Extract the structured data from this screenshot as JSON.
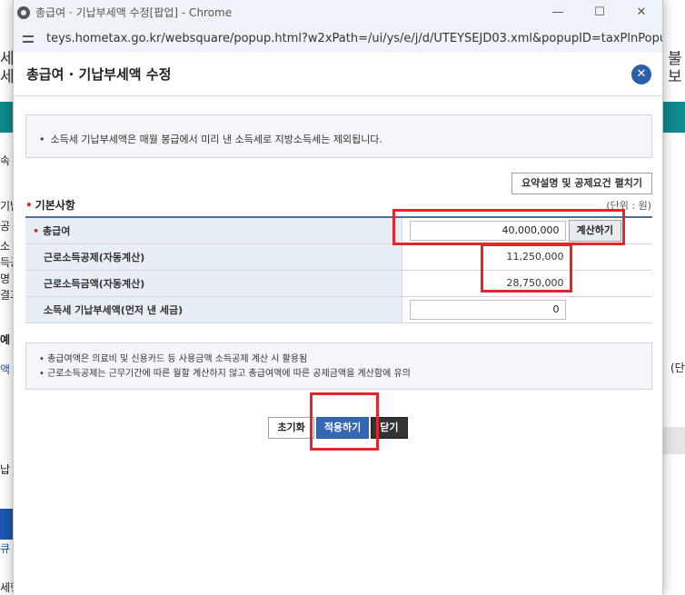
{
  "window": {
    "title": "총급여 · 기납부세액 수정[팝업] - Chrome",
    "url": "teys.hometax.go.kr/websquare/popup.html?w2xPath=/ui/ys/e/j/d/UTEYSEJD03.xml&popupID=taxPlnPopup&idx=idx..."
  },
  "popup": {
    "title": "총급여 · 기납부세액 수정",
    "notice": "소득세 기납부세액은 매월 봉급에서 미리 낸 소득세로 지방소득세는 제외됩니다.",
    "summary_button": "요약설명 및 공제요건 펼치기",
    "section_title": "기본사항",
    "unit_label": "(단위 : 원)",
    "rows": {
      "gross_salary": {
        "label": "총급여",
        "value": "40,000,000",
        "calc_button": "계산하기"
      },
      "earned_income_deduction": {
        "label": "근로소득공제(자동계산)",
        "value": "11,250,000"
      },
      "earned_income_amount": {
        "label": "근로소득금액(자동계산)",
        "value": "28,750,000"
      },
      "prepaid_tax": {
        "label": "소득세 기납부세액(먼저 낸 세금)",
        "value": "0"
      }
    },
    "notes": [
      "총급여액은 의료비 및 신용카드 등 사용금액 소득공제 계산 시 활용됨",
      "근로소득공제는 근무기간에 따른 월할 계산하지 않고 총급여액에 따른 공제금액을 계산함에 유의"
    ],
    "actions": {
      "reset": "초기화",
      "apply": "적용하기",
      "close": "닫기"
    }
  },
  "background": {
    "fragments": [
      "세",
      "세",
      "봅",
      "속",
      "기납",
      "공",
      "소",
      "득공",
      "명",
      "결과",
      "예",
      "액",
      "(단",
      "납",
      "큐",
      "세형",
      "불",
      "보"
    ]
  },
  "colors": {
    "accent": "#3567b5",
    "highlight": "#e4252a",
    "teal": "#0f8a8d"
  }
}
